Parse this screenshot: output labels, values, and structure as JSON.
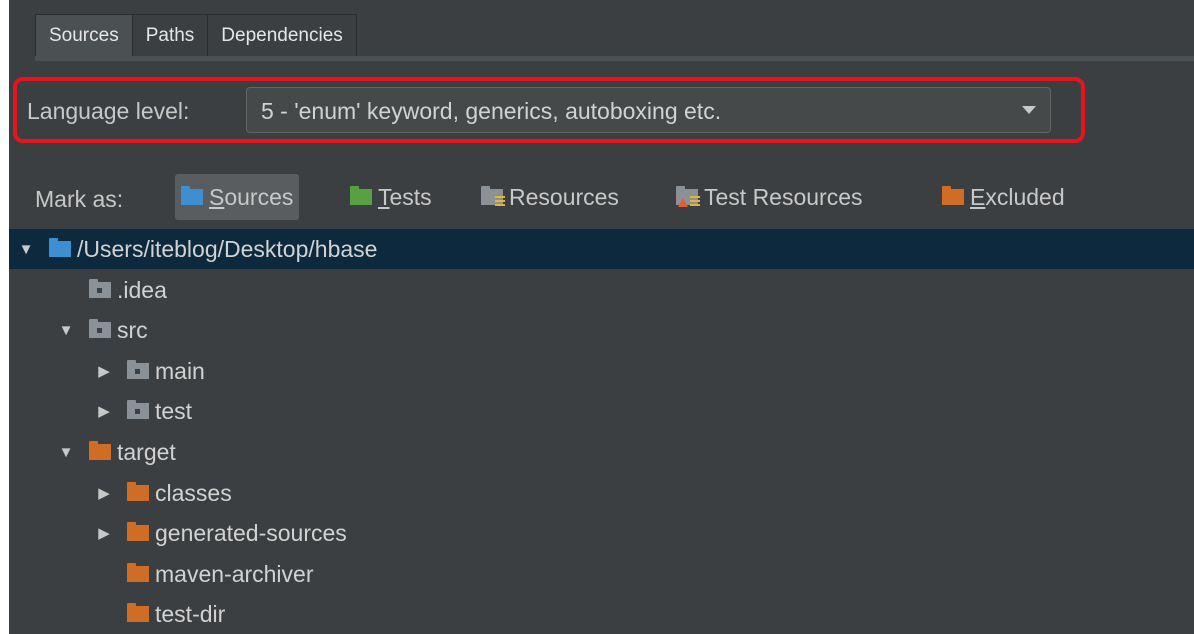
{
  "tabs": [
    "Sources",
    "Paths",
    "Dependencies"
  ],
  "language_level": {
    "label": "Language level:",
    "value": "5 - 'enum' keyword, generics, autoboxing etc."
  },
  "mark_as": {
    "label": "Mark as:",
    "sources": {
      "mnemonic": "S",
      "rest": "ources"
    },
    "tests": {
      "mnemonic": "T",
      "rest": "ests"
    },
    "resources": "Resources",
    "test_resources": "Test Resources",
    "excluded": {
      "mnemonic": "E",
      "rest": "xcluded"
    }
  },
  "tree": [
    {
      "label": "/Users/iteblog/Desktop/hbase",
      "depth": 0,
      "arrow": "▼",
      "icon": "folder-blue",
      "selected": true
    },
    {
      "label": ".idea",
      "depth": 1,
      "arrow": "",
      "icon": "folder-grey"
    },
    {
      "label": "src",
      "depth": 1,
      "arrow": "▼",
      "icon": "folder-grey"
    },
    {
      "label": "main",
      "depth": 2,
      "arrow": "▶",
      "icon": "folder-grey"
    },
    {
      "label": "test",
      "depth": 2,
      "arrow": "▶",
      "icon": "folder-grey"
    },
    {
      "label": "target",
      "depth": 1,
      "arrow": "▼",
      "icon": "folder-orange"
    },
    {
      "label": "classes",
      "depth": 2,
      "arrow": "▶",
      "icon": "folder-orange"
    },
    {
      "label": "generated-sources",
      "depth": 2,
      "arrow": "▶",
      "icon": "folder-orange"
    },
    {
      "label": "maven-archiver",
      "depth": 2,
      "arrow": "",
      "icon": "folder-orange"
    },
    {
      "label": "test-dir",
      "depth": 2,
      "arrow": "",
      "icon": "folder-orange"
    }
  ],
  "colors": {
    "panel_bg": "#3c3f41",
    "selection_bg": "#0d293e",
    "highlight_border": "#e8141b",
    "sources_folder": "#3d8fd1",
    "tests_folder": "#58a042",
    "excluded_folder": "#cf6d25"
  }
}
